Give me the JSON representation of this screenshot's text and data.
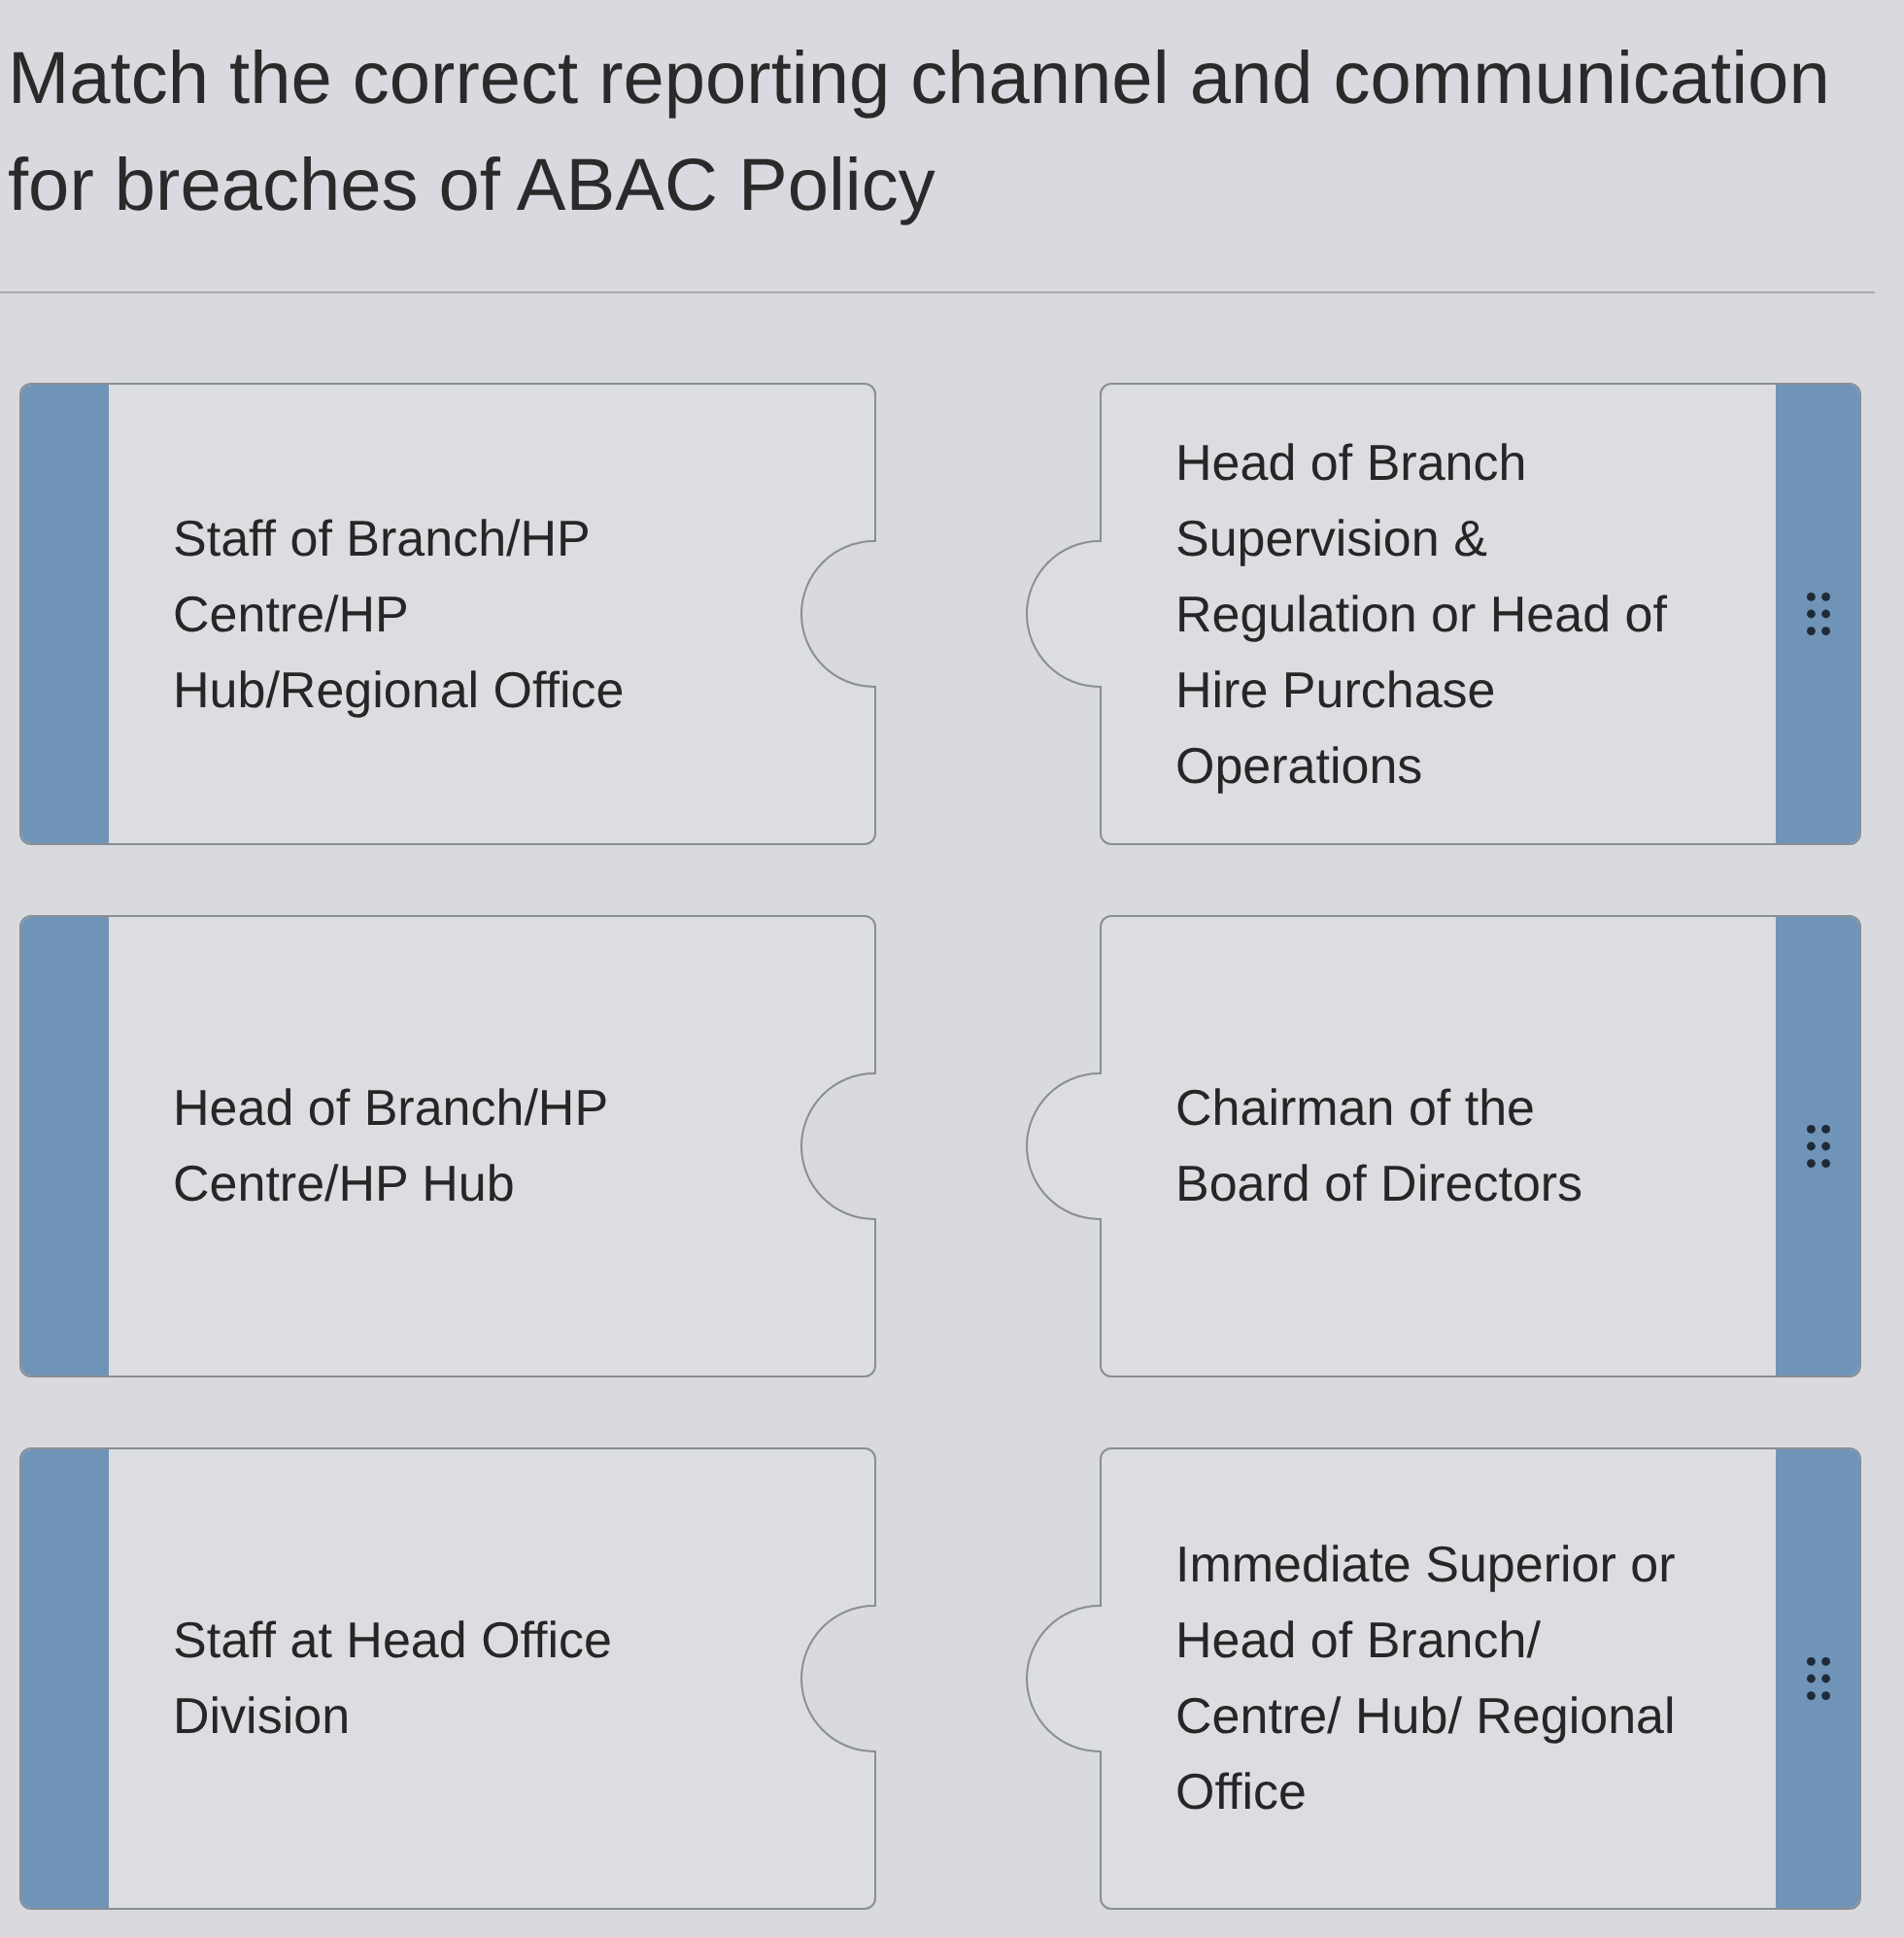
{
  "question": {
    "title": "Match the correct reporting channel and communication for breaches of ABAC Policy"
  },
  "pairs": [
    {
      "prompt": "Staff of Branch/HP Centre/HP Hub/Regional Office",
      "answer": "Head of Branch Supervision & Regulation or Head of Hire Purchase Operations"
    },
    {
      "prompt": "Head of Branch/HP Centre/HP Hub",
      "answer": "Chairman of the Board of Directors"
    },
    {
      "prompt": "Staff at Head Office Division",
      "answer": "Immediate Superior or Head of Branch/ Centre/ Hub/ Regional Office"
    }
  ]
}
